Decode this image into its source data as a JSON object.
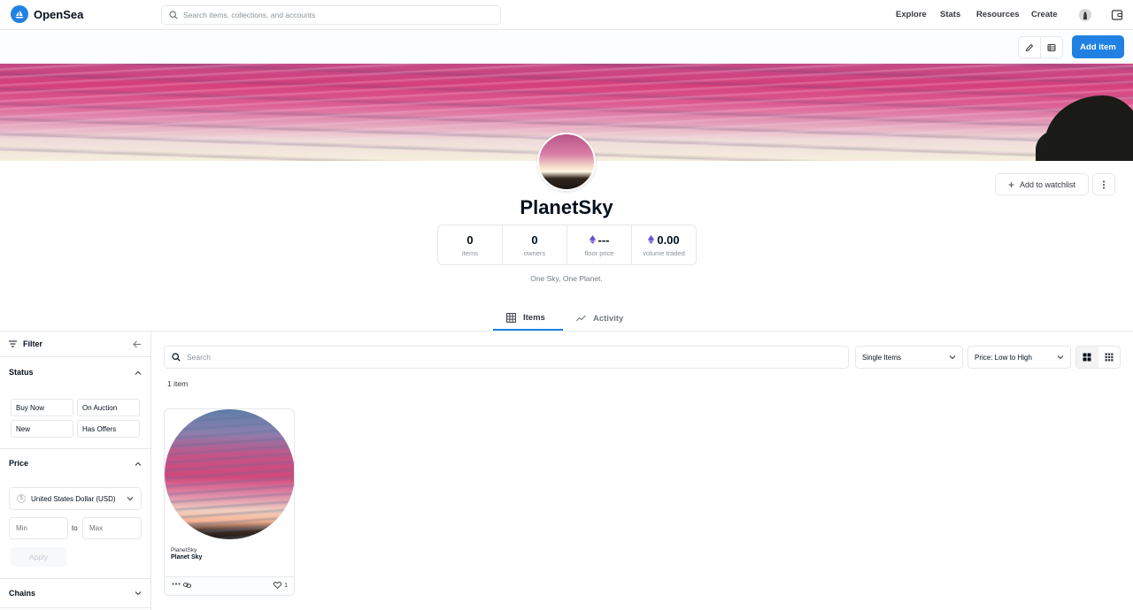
{
  "header": {
    "logo_text": "OpenSea",
    "search_placeholder": "Search items, collections, and accounts",
    "nav": [
      "Explore",
      "Stats",
      "Resources",
      "Create"
    ]
  },
  "toolbar": {
    "add_item_label": "Add item"
  },
  "collection": {
    "name": "PlanetSky",
    "description": "One Sky, One Planet.",
    "watchlist_label": "Add to watchlist",
    "stats": [
      {
        "value": "0",
        "label": "items"
      },
      {
        "value": "0",
        "label": "owners"
      },
      {
        "value": "---",
        "label": "floor price"
      },
      {
        "value": "0.00",
        "label": "volume traded"
      }
    ]
  },
  "tabs": [
    {
      "label": "Items",
      "active": true
    },
    {
      "label": "Activity",
      "active": false
    }
  ],
  "sidebar": {
    "filter_label": "Filter",
    "status_label": "Status",
    "status_options": [
      "Buy Now",
      "On Auction",
      "New",
      "Has Offers"
    ],
    "price_label": "Price",
    "currency": "United States Dollar (USD)",
    "min_placeholder": "Min",
    "to_label": "to",
    "max_placeholder": "Max",
    "apply_label": "Apply",
    "chains_label": "Chains"
  },
  "main": {
    "search_placeholder": "Search",
    "item_type": "Single Items",
    "sort": "Price: Low to High",
    "count_text": "1 item",
    "items": [
      {
        "collection": "PlanetSky",
        "name": "Planet Sky",
        "favorites": "1"
      }
    ]
  },
  "colors": {
    "accent": "#2081e2",
    "text": "#04111d",
    "border": "#e5e8eb",
    "muted": "#8a939b"
  }
}
